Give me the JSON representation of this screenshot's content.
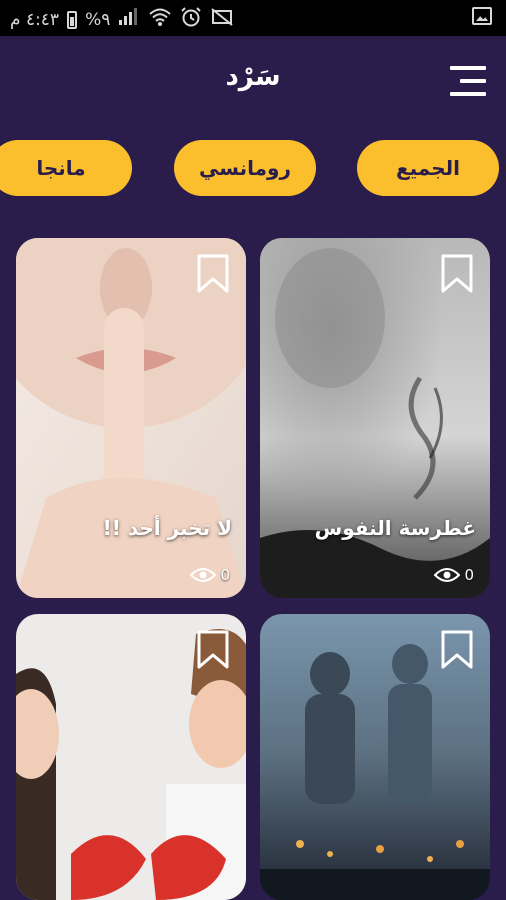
{
  "status_bar": {
    "time": "٤:٤٣ م",
    "battery_percent": "%٩"
  },
  "app": {
    "title": "سَرْد"
  },
  "chips": [
    {
      "label": "الجميع"
    },
    {
      "label": "رومانسي"
    },
    {
      "label": "مانجا"
    }
  ],
  "stories": [
    {
      "title": "غطرسة النفوس",
      "views": "0"
    },
    {
      "title": "لا تخبر أحد !!",
      "views": "0"
    },
    {
      "title": "",
      "views": ""
    },
    {
      "title": "",
      "views": ""
    }
  ],
  "colors": {
    "background": "#2a1d4b",
    "accent": "#fbbf2e",
    "status_bar": "#000000"
  }
}
